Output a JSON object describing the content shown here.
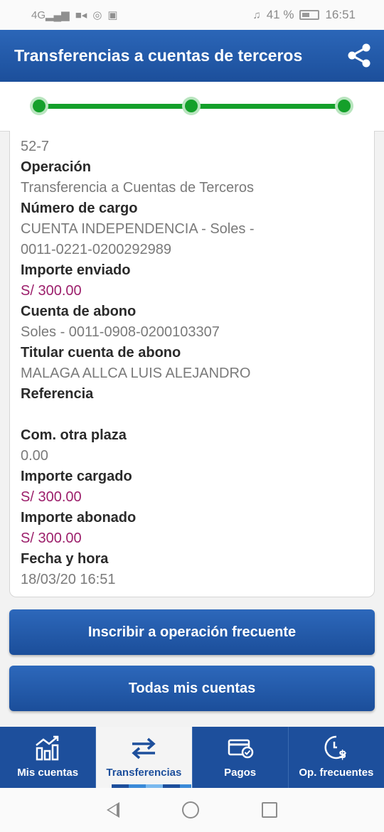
{
  "status_bar": {
    "network": "4G",
    "battery_percent": "41 %",
    "time": "16:51",
    "icons": [
      "signal-icon",
      "video-icon",
      "whatsapp-icon",
      "facebook-icon",
      "headset-icon",
      "battery-icon"
    ]
  },
  "header": {
    "title": "Transferencias a cuentas de terceros",
    "share_icon": "share-icon"
  },
  "stepper": {
    "total_steps": 3,
    "completed_steps": 3,
    "color": "#14a02a"
  },
  "details": {
    "account_partial": "52-7",
    "operacion_label": "Operación",
    "operacion_value": "Transferencia a Cuentas de Terceros",
    "cargo_label": "Número de cargo",
    "cargo_value_1": "CUENTA INDEPENDENCIA - Soles -",
    "cargo_value_2": "0011-0221-0200292989",
    "enviado_label": "Importe enviado",
    "enviado_value": "S/ 300.00",
    "abono_label": "Cuenta de abono",
    "abono_value": "Soles - 0011-0908-0200103307",
    "titular_label": "Titular cuenta de abono",
    "titular_value": "MALAGA ALLCA LUIS ALEJANDRO",
    "referencia_label": "Referencia",
    "referencia_value": "",
    "com_label": "Com. otra plaza",
    "com_value": "0.00",
    "cargado_label": "Importe cargado",
    "cargado_value": "S/ 300.00",
    "abonado_label": "Importe abonado",
    "abonado_value": "S/ 300.00",
    "fecha_label": "Fecha y hora",
    "fecha_value": "18/03/20  16:51"
  },
  "buttons": {
    "inscribir": "Inscribir a operación frecuente",
    "cuentas": "Todas mis cuentas"
  },
  "bottom_nav": [
    {
      "label": "Mis cuentas",
      "icon": "chart-icon"
    },
    {
      "label": "Transferencias",
      "icon": "transfer-arrows-icon",
      "active": true
    },
    {
      "label": "Pagos",
      "icon": "card-check-icon"
    },
    {
      "label": "Op. frecuentes",
      "icon": "clock-dollar-icon"
    }
  ],
  "colors": {
    "primary": "#1d4f9c",
    "amount": "#9c1f6b",
    "success": "#14a02a"
  }
}
